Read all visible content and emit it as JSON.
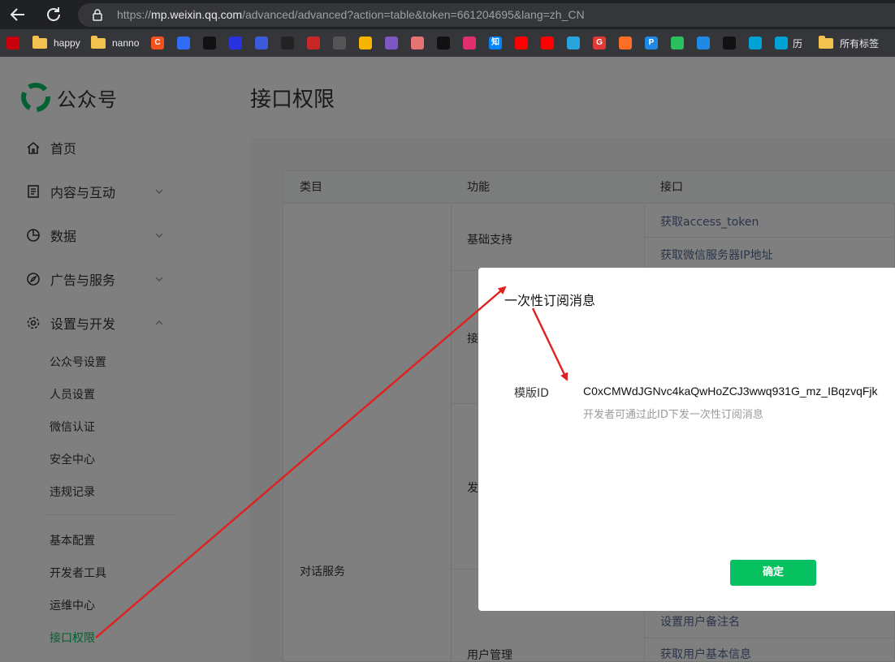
{
  "browser": {
    "url_prefix": "https://",
    "url_host": "mp.weixin.qq.com",
    "url_rest": "/advanced/advanced?action=table&token=661204695&lang=zh_CN"
  },
  "bookmarks": [
    {
      "name": "huawei-icon",
      "label": "",
      "color": "#c7000b"
    },
    {
      "name": "folder-icon",
      "label": "happy"
    },
    {
      "name": "folder-icon",
      "label": "nanno"
    },
    {
      "name": "c-icon",
      "label": "",
      "color": "#f4511e",
      "glyph": "C"
    },
    {
      "name": "lanhu-icon",
      "label": "",
      "color": "#2f6df6"
    },
    {
      "name": "app-icon",
      "label": "",
      "color": "#111111"
    },
    {
      "name": "baidu-icon",
      "label": "",
      "color": "#2932e1"
    },
    {
      "name": "at-icon",
      "label": "",
      "color": "#3b5bdb"
    },
    {
      "name": "d-icon",
      "label": "",
      "color": "#222222"
    },
    {
      "name": "seal-icon",
      "label": "",
      "color": "#c62828"
    },
    {
      "name": "bird-icon",
      "label": "",
      "color": "#555555"
    },
    {
      "name": "eye-icon",
      "label": "",
      "color": "#f4b400"
    },
    {
      "name": "play-icon",
      "label": "",
      "color": "#7e57c2"
    },
    {
      "name": "fish-icon",
      "label": "",
      "color": "#e57373"
    },
    {
      "name": "github-icon",
      "label": "",
      "color": "#111111"
    },
    {
      "name": "instagram-icon",
      "label": "",
      "color": "#e1306c"
    },
    {
      "name": "zhihu-icon",
      "label": "",
      "color": "#0084ff",
      "glyph": "知"
    },
    {
      "name": "youtube-icon",
      "label": "",
      "color": "#ff0000"
    },
    {
      "name": "youtube-music-icon",
      "label": "",
      "color": "#ff0000"
    },
    {
      "name": "telegram-icon",
      "label": "",
      "color": "#2aa3dd"
    },
    {
      "name": "g-icon",
      "label": "",
      "color": "#e53935",
      "glyph": "G"
    },
    {
      "name": "gitlab-icon",
      "label": "",
      "color": "#fc6d26"
    },
    {
      "name": "p-icon",
      "label": "",
      "color": "#1e88e5",
      "glyph": "P"
    },
    {
      "name": "evernote-icon",
      "label": "",
      "color": "#2dbe60"
    },
    {
      "name": "bolt-icon",
      "label": "",
      "color": "#1e88e5"
    },
    {
      "name": "cube-icon",
      "label": "",
      "color": "#111111"
    },
    {
      "name": "bilibili-icon",
      "label": "",
      "color": "#00a1d6"
    },
    {
      "name": "bilibili-icon",
      "label": "历",
      "color": "#00a1d6"
    },
    {
      "name": "folder-icon",
      "label": "所有标签"
    }
  ],
  "sidebar": {
    "brand": "公众号",
    "items": [
      {
        "label": "首页"
      },
      {
        "label": "内容与互动"
      },
      {
        "label": "数据"
      },
      {
        "label": "广告与服务"
      },
      {
        "label": "设置与开发"
      }
    ],
    "sub_items": [
      "公众号设置",
      "人员设置",
      "微信认证",
      "安全中心",
      "违规记录"
    ],
    "sub_items2": [
      "基本配置",
      "开发者工具",
      "运维中心",
      "接口权限"
    ]
  },
  "main": {
    "title": "接口权限",
    "table": {
      "headers": [
        "类目",
        "功能",
        "接口"
      ],
      "category": "对话服务",
      "features": [
        "基础支持",
        "接",
        "发",
        "用户管理"
      ],
      "apis": [
        "获取access_token",
        "获取微信服务器IP地址",
        "设置用户备注名",
        "获取用户基本信息"
      ]
    }
  },
  "modal": {
    "title": "一次性订阅消息",
    "id_label": "模版ID",
    "template_id": "C0xCMWdJGNvc4kaQwHoZCJ3wwq931G_mz_IBqzvqFjk",
    "description": "开发者可通过此ID下发一次性订阅消息",
    "confirm_label": "确定"
  },
  "colors": {
    "accent": "#07c160",
    "annotation": "#e02020"
  }
}
